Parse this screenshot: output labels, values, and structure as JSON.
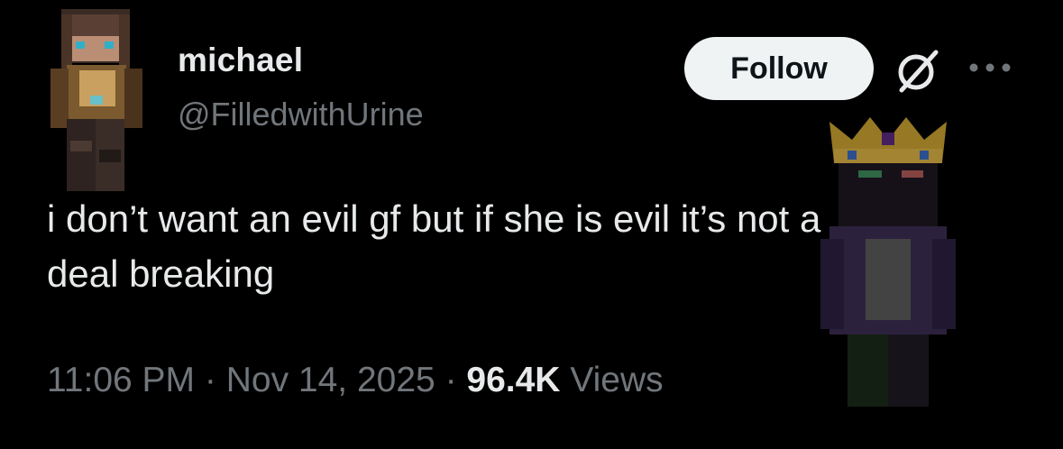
{
  "author": {
    "display_name": "michael",
    "handle": "@FilledwithUrine",
    "avatar_icon": "minecraft-character-avatar"
  },
  "actions": {
    "follow_label": "Follow",
    "grok_icon": "grok-slash-icon",
    "more_icon": "more-options-icon"
  },
  "tweet": {
    "text": "i don’t want an evil gf but if she is evil it’s not a\ndeal breaking"
  },
  "meta": {
    "time": "11:06 PM",
    "sep1": " · ",
    "date": "Nov 14, 2025",
    "sep2": " · ",
    "views_count": "96.4K",
    "views_label": " Views"
  },
  "colors": {
    "background": "#000000",
    "primary_text": "#e7e9ea",
    "secondary_text": "#71767b",
    "follow_bg": "#eff3f4",
    "follow_text": "#0f1419"
  }
}
